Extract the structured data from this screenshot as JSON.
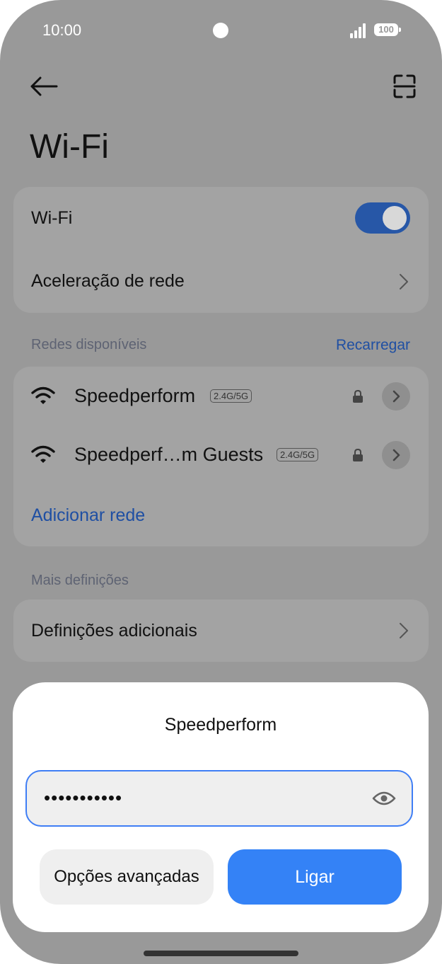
{
  "status_bar": {
    "time": "10:00",
    "battery": "100"
  },
  "header": {
    "title": "Wi-Fi"
  },
  "wifi_card": {
    "wifi_label": "Wi-Fi",
    "wifi_enabled": true,
    "acceleration_label": "Aceleração de rede"
  },
  "available_networks": {
    "section_label": "Redes disponíveis",
    "reload_label": "Recarregar",
    "networks": [
      {
        "name": "Speedperform",
        "band": "2.4G/5G",
        "secured": true
      },
      {
        "name": "Speedperf…m Guests",
        "band": "2.4G/5G",
        "secured": true
      }
    ],
    "add_network_label": "Adicionar rede"
  },
  "more_settings": {
    "section_label": "Mais definições",
    "additional_label": "Definições adicionais"
  },
  "dialog": {
    "title": "Speedperform",
    "password_value": "•••••••••••",
    "advanced_label": "Opções avançadas",
    "connect_label": "Ligar"
  },
  "colors": {
    "accent": "#3482f6",
    "link": "#1f4fa3",
    "toggle_on": "#2757a7",
    "scrim": "#999999"
  },
  "icons": [
    "arrow-left-icon",
    "scan-icon",
    "chevron-right-icon",
    "wifi-icon",
    "lock-icon",
    "eye-icon"
  ]
}
